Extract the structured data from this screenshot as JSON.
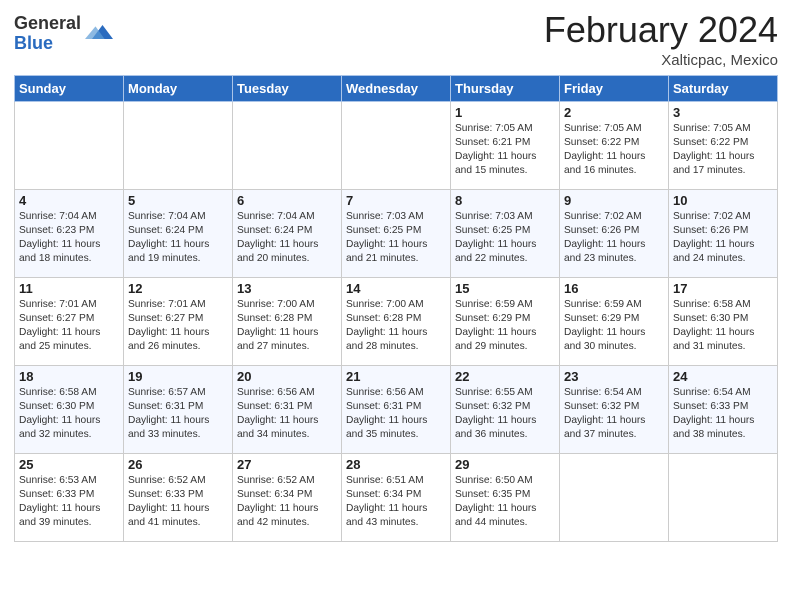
{
  "header": {
    "logo_general": "General",
    "logo_blue": "Blue",
    "month_year": "February 2024",
    "location": "Xalticpac, Mexico"
  },
  "weekdays": [
    "Sunday",
    "Monday",
    "Tuesday",
    "Wednesday",
    "Thursday",
    "Friday",
    "Saturday"
  ],
  "weeks": [
    [
      {
        "day": "",
        "info": ""
      },
      {
        "day": "",
        "info": ""
      },
      {
        "day": "",
        "info": ""
      },
      {
        "day": "",
        "info": ""
      },
      {
        "day": "1",
        "info": "Sunrise: 7:05 AM\nSunset: 6:21 PM\nDaylight: 11 hours and 15 minutes."
      },
      {
        "day": "2",
        "info": "Sunrise: 7:05 AM\nSunset: 6:22 PM\nDaylight: 11 hours and 16 minutes."
      },
      {
        "day": "3",
        "info": "Sunrise: 7:05 AM\nSunset: 6:22 PM\nDaylight: 11 hours and 17 minutes."
      }
    ],
    [
      {
        "day": "4",
        "info": "Sunrise: 7:04 AM\nSunset: 6:23 PM\nDaylight: 11 hours and 18 minutes."
      },
      {
        "day": "5",
        "info": "Sunrise: 7:04 AM\nSunset: 6:24 PM\nDaylight: 11 hours and 19 minutes."
      },
      {
        "day": "6",
        "info": "Sunrise: 7:04 AM\nSunset: 6:24 PM\nDaylight: 11 hours and 20 minutes."
      },
      {
        "day": "7",
        "info": "Sunrise: 7:03 AM\nSunset: 6:25 PM\nDaylight: 11 hours and 21 minutes."
      },
      {
        "day": "8",
        "info": "Sunrise: 7:03 AM\nSunset: 6:25 PM\nDaylight: 11 hours and 22 minutes."
      },
      {
        "day": "9",
        "info": "Sunrise: 7:02 AM\nSunset: 6:26 PM\nDaylight: 11 hours and 23 minutes."
      },
      {
        "day": "10",
        "info": "Sunrise: 7:02 AM\nSunset: 6:26 PM\nDaylight: 11 hours and 24 minutes."
      }
    ],
    [
      {
        "day": "11",
        "info": "Sunrise: 7:01 AM\nSunset: 6:27 PM\nDaylight: 11 hours and 25 minutes."
      },
      {
        "day": "12",
        "info": "Sunrise: 7:01 AM\nSunset: 6:27 PM\nDaylight: 11 hours and 26 minutes."
      },
      {
        "day": "13",
        "info": "Sunrise: 7:00 AM\nSunset: 6:28 PM\nDaylight: 11 hours and 27 minutes."
      },
      {
        "day": "14",
        "info": "Sunrise: 7:00 AM\nSunset: 6:28 PM\nDaylight: 11 hours and 28 minutes."
      },
      {
        "day": "15",
        "info": "Sunrise: 6:59 AM\nSunset: 6:29 PM\nDaylight: 11 hours and 29 minutes."
      },
      {
        "day": "16",
        "info": "Sunrise: 6:59 AM\nSunset: 6:29 PM\nDaylight: 11 hours and 30 minutes."
      },
      {
        "day": "17",
        "info": "Sunrise: 6:58 AM\nSunset: 6:30 PM\nDaylight: 11 hours and 31 minutes."
      }
    ],
    [
      {
        "day": "18",
        "info": "Sunrise: 6:58 AM\nSunset: 6:30 PM\nDaylight: 11 hours and 32 minutes."
      },
      {
        "day": "19",
        "info": "Sunrise: 6:57 AM\nSunset: 6:31 PM\nDaylight: 11 hours and 33 minutes."
      },
      {
        "day": "20",
        "info": "Sunrise: 6:56 AM\nSunset: 6:31 PM\nDaylight: 11 hours and 34 minutes."
      },
      {
        "day": "21",
        "info": "Sunrise: 6:56 AM\nSunset: 6:31 PM\nDaylight: 11 hours and 35 minutes."
      },
      {
        "day": "22",
        "info": "Sunrise: 6:55 AM\nSunset: 6:32 PM\nDaylight: 11 hours and 36 minutes."
      },
      {
        "day": "23",
        "info": "Sunrise: 6:54 AM\nSunset: 6:32 PM\nDaylight: 11 hours and 37 minutes."
      },
      {
        "day": "24",
        "info": "Sunrise: 6:54 AM\nSunset: 6:33 PM\nDaylight: 11 hours and 38 minutes."
      }
    ],
    [
      {
        "day": "25",
        "info": "Sunrise: 6:53 AM\nSunset: 6:33 PM\nDaylight: 11 hours and 39 minutes."
      },
      {
        "day": "26",
        "info": "Sunrise: 6:52 AM\nSunset: 6:33 PM\nDaylight: 11 hours and 41 minutes."
      },
      {
        "day": "27",
        "info": "Sunrise: 6:52 AM\nSunset: 6:34 PM\nDaylight: 11 hours and 42 minutes."
      },
      {
        "day": "28",
        "info": "Sunrise: 6:51 AM\nSunset: 6:34 PM\nDaylight: 11 hours and 43 minutes."
      },
      {
        "day": "29",
        "info": "Sunrise: 6:50 AM\nSunset: 6:35 PM\nDaylight: 11 hours and 44 minutes."
      },
      {
        "day": "",
        "info": ""
      },
      {
        "day": "",
        "info": ""
      }
    ]
  ]
}
